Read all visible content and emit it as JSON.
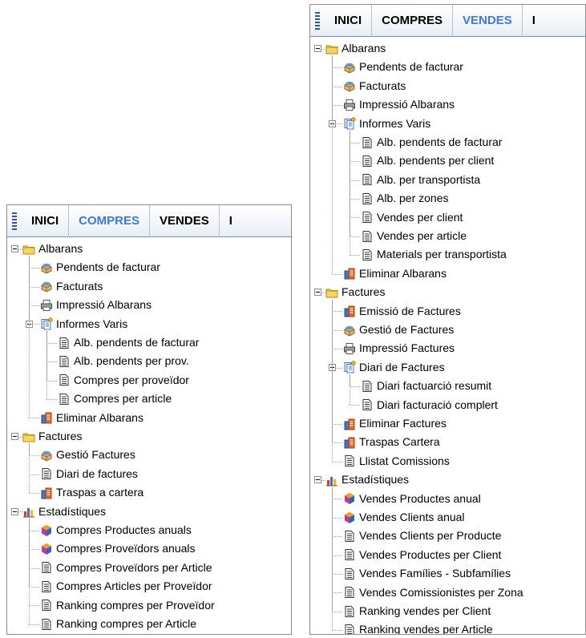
{
  "left": {
    "tabs": [
      "INICI",
      "COMPRES",
      "VENDES",
      "I"
    ],
    "active_tab": "COMPRES",
    "tree": [
      {
        "label": "Albarans",
        "icon": "folder-icon",
        "level": 0,
        "expanded": true
      },
      {
        "label": "Pendents de facturar",
        "icon": "box-icon",
        "level": 1
      },
      {
        "label": "Facturats",
        "icon": "box-icon",
        "level": 1
      },
      {
        "label": "Impressió Albarans",
        "icon": "printer-icon",
        "level": 1
      },
      {
        "label": "Informes Varis",
        "icon": "report-group-icon",
        "level": 1,
        "expanded": true
      },
      {
        "label": "Alb. pendents de facturar",
        "icon": "document-icon",
        "level": 2
      },
      {
        "label": "Alb. pendents per prov.",
        "icon": "document-icon",
        "level": 2
      },
      {
        "label": "Compres per proveïdor",
        "icon": "document-icon",
        "level": 2
      },
      {
        "label": "Compres per article",
        "icon": "document-icon",
        "level": 2
      },
      {
        "label": "Eliminar Albarans",
        "icon": "delete-icon",
        "level": 1
      },
      {
        "label": "Factures",
        "icon": "folder-icon",
        "level": 0,
        "expanded": true
      },
      {
        "label": "Gestió Factures",
        "icon": "box-icon",
        "level": 1
      },
      {
        "label": "Diari de factures",
        "icon": "document-icon",
        "level": 1
      },
      {
        "label": "Traspas a cartera",
        "icon": "delete-icon",
        "level": 1
      },
      {
        "label": "Estadístiques",
        "icon": "chart-icon",
        "level": 0,
        "expanded": true
      },
      {
        "label": "Compres Productes anuals",
        "icon": "cube-icon",
        "level": 1
      },
      {
        "label": "Compres Proveïdors anuals",
        "icon": "cube-icon",
        "level": 1
      },
      {
        "label": "Compres Proveïdors per Article",
        "icon": "document-icon",
        "level": 1
      },
      {
        "label": "Compres Articles per Proveïdor",
        "icon": "document-icon",
        "level": 1
      },
      {
        "label": "Ranking compres per Proveïdor",
        "icon": "document-icon",
        "level": 1
      },
      {
        "label": "Ranking compres per Article",
        "icon": "document-icon",
        "level": 1
      }
    ]
  },
  "right": {
    "tabs": [
      "INICI",
      "COMPRES",
      "VENDES",
      "I"
    ],
    "active_tab": "VENDES",
    "tree": [
      {
        "label": "Albarans",
        "icon": "folder-icon",
        "level": 0,
        "expanded": true
      },
      {
        "label": "Pendents de facturar",
        "icon": "box-icon",
        "level": 1
      },
      {
        "label": "Facturats",
        "icon": "box-icon",
        "level": 1
      },
      {
        "label": "Impressió Albarans",
        "icon": "printer-icon",
        "level": 1
      },
      {
        "label": "Informes Varis",
        "icon": "report-group-icon",
        "level": 1,
        "expanded": true
      },
      {
        "label": "Alb. pendents de facturar",
        "icon": "document-icon",
        "level": 2
      },
      {
        "label": "Alb. pendents per client",
        "icon": "document-icon",
        "level": 2
      },
      {
        "label": "Alb. per transportista",
        "icon": "document-icon",
        "level": 2
      },
      {
        "label": "Alb. per zones",
        "icon": "document-icon",
        "level": 2
      },
      {
        "label": "Vendes per client",
        "icon": "document-icon",
        "level": 2
      },
      {
        "label": "Vendes per article",
        "icon": "document-icon",
        "level": 2
      },
      {
        "label": "Materials per transportista",
        "icon": "document-icon",
        "level": 2
      },
      {
        "label": "Eliminar Albarans",
        "icon": "delete-icon",
        "level": 1
      },
      {
        "label": "Factures",
        "icon": "folder-icon",
        "level": 0,
        "expanded": true
      },
      {
        "label": "Emissió de Factures",
        "icon": "delete-icon",
        "level": 1
      },
      {
        "label": "Gestió de Factures",
        "icon": "box-icon",
        "level": 1
      },
      {
        "label": "Impressió Factures",
        "icon": "printer-icon",
        "level": 1
      },
      {
        "label": "Diari de Factures",
        "icon": "report-group-icon",
        "level": 1,
        "expanded": true
      },
      {
        "label": "Diari factuarció resumit",
        "icon": "document-icon",
        "level": 2
      },
      {
        "label": "Diari facturació complert",
        "icon": "document-icon",
        "level": 2
      },
      {
        "label": "Eliminar Factures",
        "icon": "delete-icon",
        "level": 1
      },
      {
        "label": "Traspas Cartera",
        "icon": "delete-icon",
        "level": 1
      },
      {
        "label": "Llistat Comissions",
        "icon": "document-icon",
        "level": 1
      },
      {
        "label": "Estadístiques",
        "icon": "chart-icon",
        "level": 0,
        "expanded": true
      },
      {
        "label": "Vendes Productes anual",
        "icon": "cube-icon",
        "level": 1
      },
      {
        "label": "Vendes Clients anual",
        "icon": "cube-icon",
        "level": 1
      },
      {
        "label": "Vendes Clients per Producte",
        "icon": "document-icon",
        "level": 1
      },
      {
        "label": "Vendes Productes per Client",
        "icon": "document-icon",
        "level": 1
      },
      {
        "label": "Vendes Famílies - Subfamílies",
        "icon": "document-icon",
        "level": 1
      },
      {
        "label": "Vendes Comissionistes per Zona",
        "icon": "document-icon",
        "level": 1
      },
      {
        "label": "Ranking vendes per Client",
        "icon": "document-icon",
        "level": 1
      },
      {
        "label": "Ranking vendes per Article",
        "icon": "document-icon",
        "level": 1
      }
    ]
  }
}
